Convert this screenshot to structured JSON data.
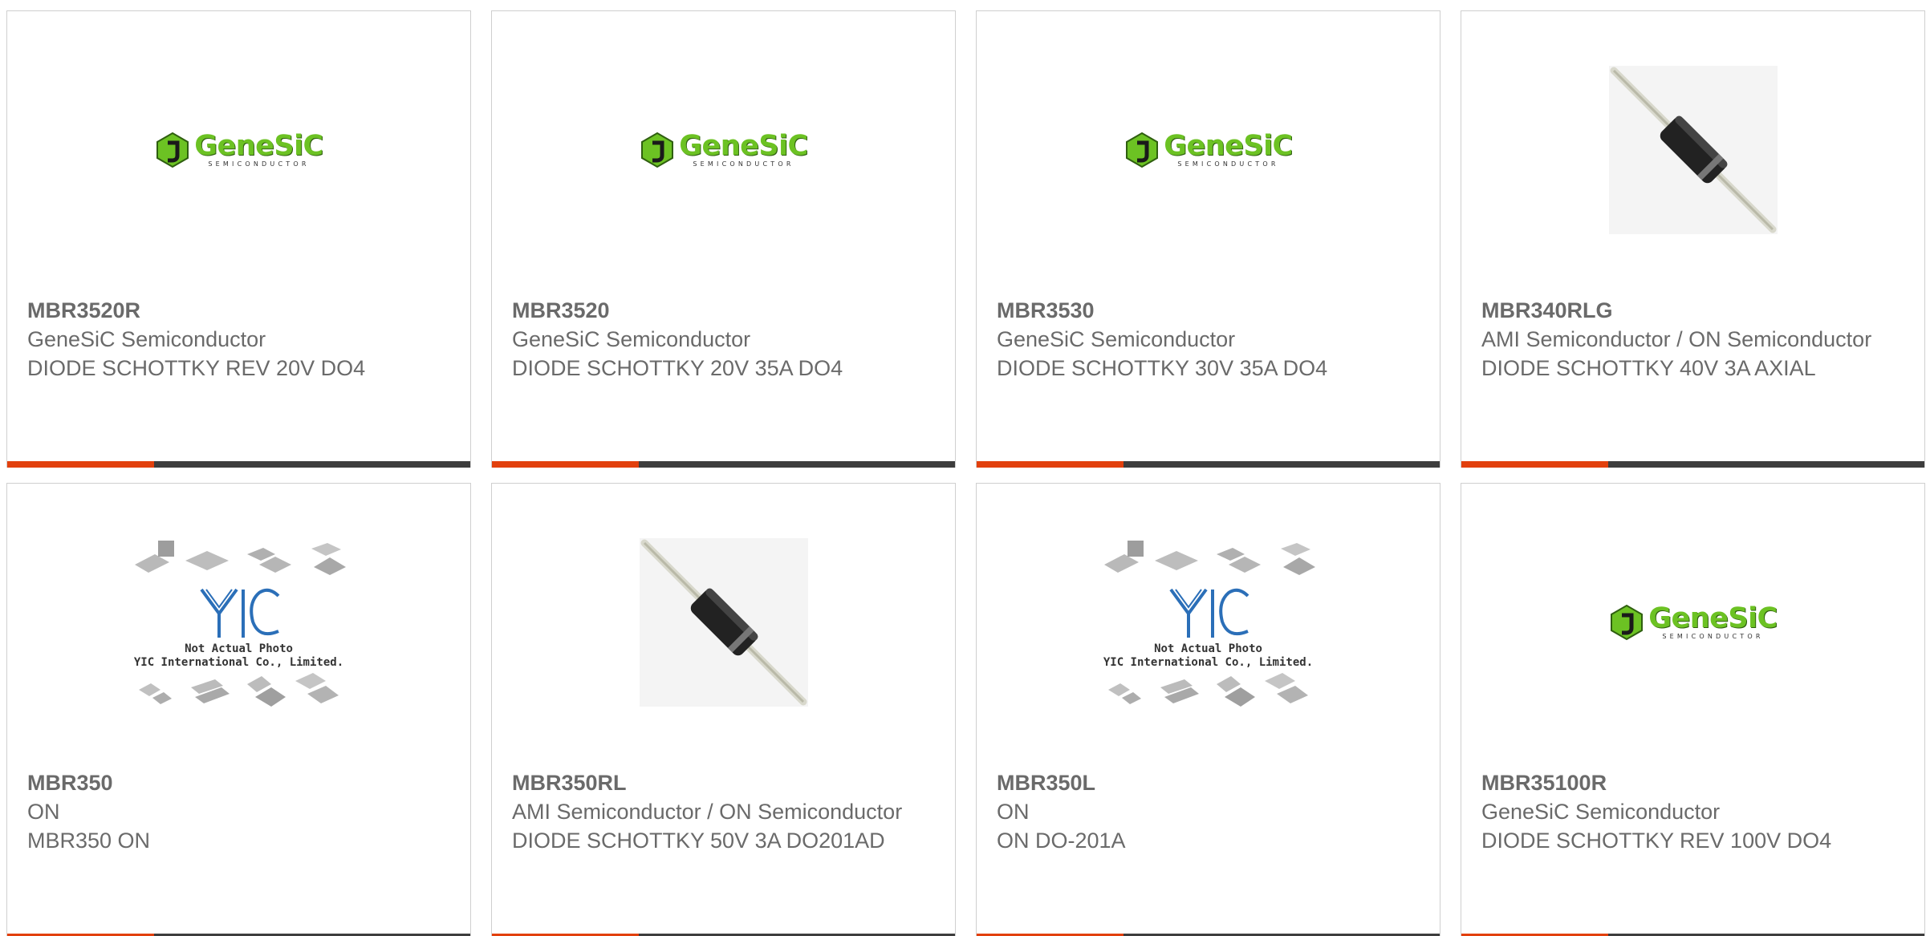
{
  "colors": {
    "accent": "#e2400d",
    "bar": "#3d3d3d",
    "genesic_green": "#6cc223"
  },
  "products": [
    {
      "part": "MBR3520R",
      "manufacturer": "GeneSiC Semiconductor",
      "description": "DIODE SCHOTTKY REV 20V DO4",
      "image": "genesic-logo"
    },
    {
      "part": "MBR3520",
      "manufacturer": "GeneSiC Semiconductor",
      "description": "DIODE SCHOTTKY 20V 35A DO4",
      "image": "genesic-logo"
    },
    {
      "part": "MBR3530",
      "manufacturer": "GeneSiC Semiconductor",
      "description": "DIODE SCHOTTKY 30V 35A DO4",
      "image": "genesic-logo"
    },
    {
      "part": "MBR340RLG",
      "manufacturer": "AMI Semiconductor / ON Semiconductor",
      "description": "DIODE SCHOTTKY 40V 3A AXIAL",
      "image": "axial-diode-photo"
    },
    {
      "part": "MBR350",
      "manufacturer": "ON",
      "description": "MBR350 ON",
      "image": "yic-placeholder"
    },
    {
      "part": "MBR350RL",
      "manufacturer": "AMI Semiconductor / ON Semiconductor",
      "description": "DIODE SCHOTTKY 50V 3A DO201AD",
      "image": "axial-diode-photo"
    },
    {
      "part": "MBR350L",
      "manufacturer": "ON",
      "description": "ON DO-201A",
      "image": "yic-placeholder"
    },
    {
      "part": "MBR35100R",
      "manufacturer": "GeneSiC Semiconductor",
      "description": "DIODE SCHOTTKY REV 100V DO4",
      "image": "genesic-logo"
    }
  ],
  "logos": {
    "genesic": {
      "name": "GeneSiC",
      "sub": "SEMICONDUCTOR"
    },
    "yic": {
      "mark": "YIC",
      "note_line1": "Not Actual Photo",
      "note_line2": "YIC International Co., Limited."
    }
  }
}
